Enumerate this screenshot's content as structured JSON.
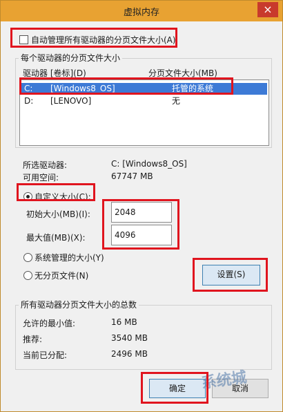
{
  "window": {
    "title": "虚拟内存",
    "close": "×"
  },
  "auto_manage": {
    "label": "自动管理所有驱动器的分页文件大小(A)",
    "checked": false
  },
  "drives_group": {
    "title": "每个驱动器的分页文件大小",
    "col_drive": "驱动器 [卷标](D)",
    "col_size": "分页文件大小(MB)",
    "rows": [
      {
        "drive": "C:",
        "label": "[Windows8_OS]",
        "size": "托管的系统",
        "selected": true
      },
      {
        "drive": "D:",
        "label": "[LENOVO]",
        "size": "无",
        "selected": false
      }
    ]
  },
  "selected_drive": {
    "label": "所选驱动器:",
    "value": "C:  [Windows8_OS]"
  },
  "free_space": {
    "label": "可用空间:",
    "value": "67747 MB"
  },
  "options": {
    "custom": "自定义大小(C):",
    "initial_label": "初始大小(MB)(I):",
    "initial_value": "2048",
    "max_label": "最大值(MB)(X):",
    "max_value": "4096",
    "system_managed": "系统管理的大小(Y)",
    "no_paging": "无分页文件(N)",
    "set_button": "设置(S)"
  },
  "totals_group": {
    "title": "所有驱动器分页文件大小的总数",
    "min_label": "允许的最小值:",
    "min_value": "16 MB",
    "recommended_label": "推荐:",
    "recommended_value": "3540 MB",
    "current_label": "当前已分配:",
    "current_value": "2496 MB"
  },
  "buttons": {
    "ok": "确定",
    "cancel": "取消"
  },
  "watermark": "系统城",
  "colors": {
    "titlebar": "#e8a232",
    "close": "#c83a2c",
    "selection": "#3d7ad6",
    "highlight": "#e0141e"
  }
}
